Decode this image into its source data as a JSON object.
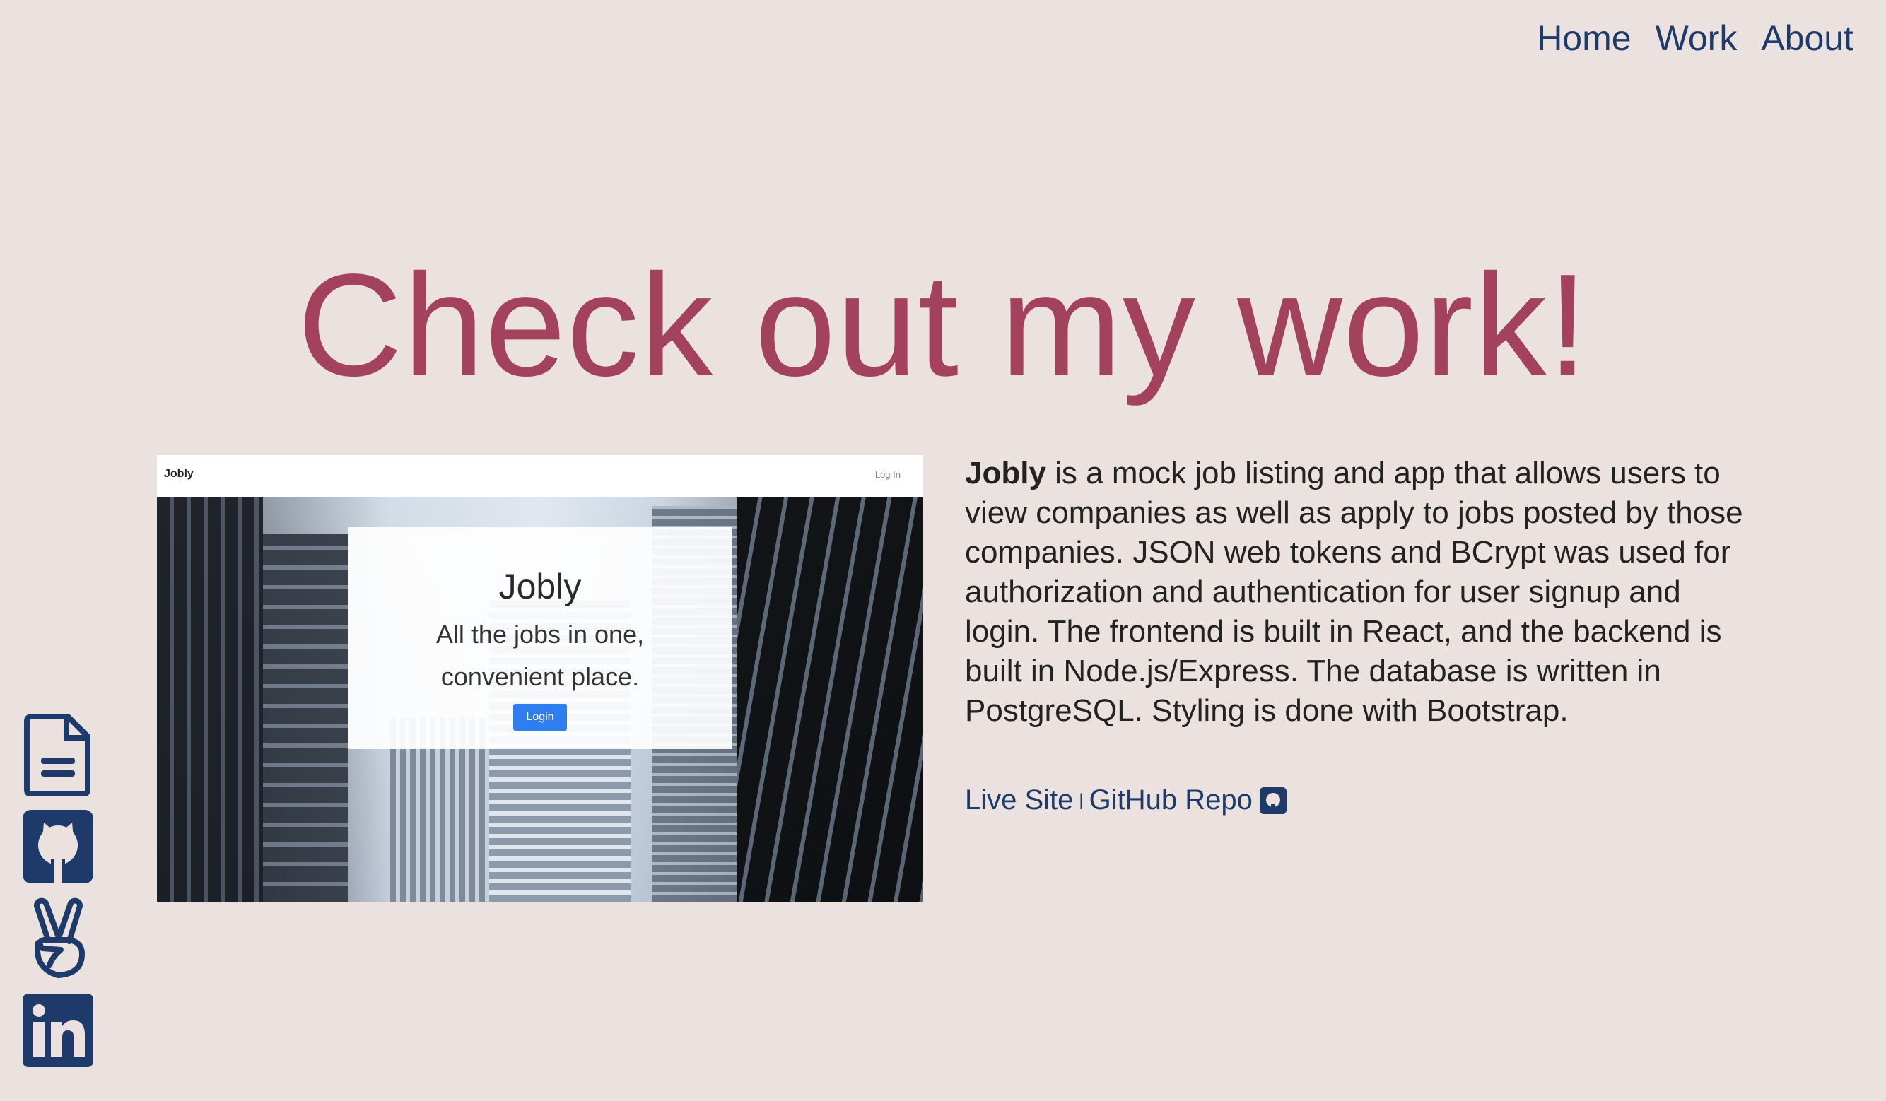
{
  "nav": {
    "home": "Home",
    "work": "Work",
    "about": "About"
  },
  "hero": {
    "title": "Check out my work!"
  },
  "project": {
    "screenshot": {
      "brand": "Jobly",
      "login_link": "Log In",
      "card_title": "Jobly",
      "card_subtitle": "All the jobs in one, convenient place.",
      "card_button": "Login"
    },
    "name": "Jobly",
    "description": "is a mock job listing and app that allows users to view companies as well as apply to jobs posted by those companies. JSON web tokens and BCrypt was used for authorization and authentication for user signup and login. The frontend is built in React, and the backend is built in Node.js/Express. The database is written in PostgreSQL. Styling is done with Bootstrap.",
    "live_site": "Live Site",
    "separator": "|",
    "repo": "GitHub Repo"
  },
  "social": {
    "icons": [
      "resume-icon",
      "github-icon",
      "angellist-icon",
      "linkedin-icon"
    ]
  },
  "colors": {
    "background": "#ebe2df",
    "accent": "#a3425f",
    "link": "#1d3a6b"
  }
}
